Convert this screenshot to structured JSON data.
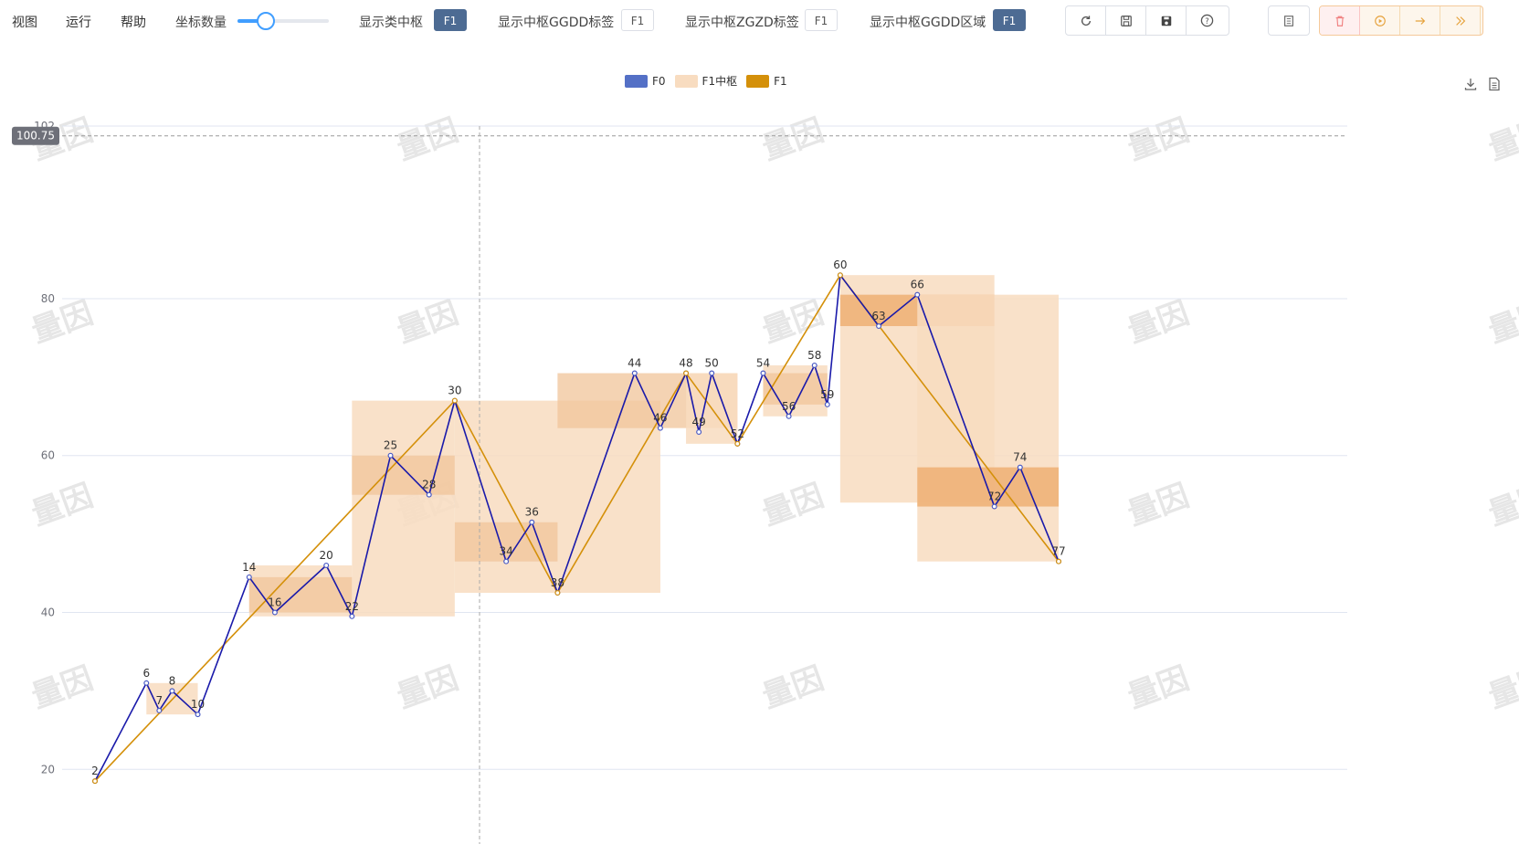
{
  "menu": {
    "view": "视图",
    "run": "运行",
    "help": "帮助"
  },
  "toolbar": {
    "axis_count_label": "坐标数量",
    "axis_count_fraction": 0.3,
    "toggles": [
      {
        "label": "显示类中枢",
        "value": "F1",
        "active": true
      },
      {
        "label": "显示中枢GGDD标签",
        "value": "F1",
        "active": false
      },
      {
        "label": "显示中枢ZGZD标签",
        "value": "F1",
        "active": false
      },
      {
        "label": "显示中枢GGDD区域",
        "value": "F1",
        "active": true
      }
    ],
    "icon_group_1": [
      "refresh-icon",
      "save-outline-icon",
      "save-filled-icon",
      "help-icon"
    ],
    "icon_group_2": [
      "document-icon"
    ],
    "icon_group_3": [
      "trash-icon",
      "play-circle-icon",
      "arrow-right-icon",
      "double-chevron-right-icon"
    ],
    "download_icon": "download-icon",
    "data_view_icon": "data-view-icon"
  },
  "watermark": "量因",
  "colors": {
    "f0": "#1a1aaa",
    "f0_legend": "#5470c6",
    "f1": "#d4900a",
    "zs_light": "#f8dcc0",
    "zs_mid": "#f0c49a",
    "zs_dark": "#eeac6e"
  },
  "chart_data": {
    "type": "line",
    "ylim": [
      12,
      102
    ],
    "yticks": [
      20,
      40,
      60,
      80
    ],
    "ytick_top": "102",
    "crosshair_value": "100.75",
    "legend": [
      {
        "name": "F0",
        "color": "#5470c6"
      },
      {
        "name": "F1中枢",
        "color": "#f8dcc0"
      },
      {
        "name": "F1",
        "color": "#d4900a"
      }
    ],
    "series": [
      {
        "name": "F0",
        "points": [
          [
            2,
            18.5
          ],
          [
            6,
            31
          ],
          [
            7,
            27.5
          ],
          [
            8,
            30
          ],
          [
            10,
            27
          ],
          [
            14,
            44.5
          ],
          [
            16,
            40
          ],
          [
            20,
            46
          ],
          [
            22,
            39.5
          ],
          [
            25,
            60
          ],
          [
            28,
            55
          ],
          [
            30,
            67
          ],
          [
            34,
            46.5
          ],
          [
            36,
            51.5
          ],
          [
            38,
            42.5
          ],
          [
            44,
            70.5
          ],
          [
            46,
            63.5
          ],
          [
            48,
            70.5
          ],
          [
            49,
            63
          ],
          [
            50,
            70.5
          ],
          [
            52,
            61.5
          ],
          [
            54,
            70.5
          ],
          [
            56,
            65
          ],
          [
            58,
            71.5
          ],
          [
            59,
            66.5
          ],
          [
            60,
            83
          ],
          [
            63,
            76.5
          ],
          [
            66,
            80.5
          ],
          [
            72,
            53.5
          ],
          [
            74,
            58.5
          ],
          [
            77,
            46.5
          ]
        ]
      },
      {
        "name": "F1",
        "points": [
          [
            2,
            18.5
          ],
          [
            30,
            67
          ],
          [
            38,
            42.5
          ],
          [
            48,
            70.5
          ],
          [
            52,
            61.5
          ],
          [
            60,
            83
          ],
          [
            77,
            46.5
          ]
        ]
      }
    ],
    "zhongshu": [
      {
        "x": [
          6,
          10
        ],
        "y": [
          27,
          31
        ],
        "tone": "light"
      },
      {
        "x": [
          14,
          22
        ],
        "y": [
          39.5,
          46
        ],
        "tone": "light"
      },
      {
        "x": [
          14,
          22
        ],
        "y": [
          40,
          44.5
        ],
        "tone": "mid"
      },
      {
        "x": [
          22,
          30
        ],
        "y": [
          39.5,
          67
        ],
        "tone": "light"
      },
      {
        "x": [
          22,
          30
        ],
        "y": [
          55,
          60
        ],
        "tone": "mid"
      },
      {
        "x": [
          30,
          46
        ],
        "y": [
          42.5,
          67
        ],
        "tone": "light"
      },
      {
        "x": [
          30,
          38
        ],
        "y": [
          46.5,
          51.5
        ],
        "tone": "mid"
      },
      {
        "x": [
          38,
          52
        ],
        "y": [
          63.5,
          70.5
        ],
        "tone": "mid"
      },
      {
        "x": [
          48,
          52
        ],
        "y": [
          61.5,
          70.5
        ],
        "tone": "light"
      },
      {
        "x": [
          54,
          59
        ],
        "y": [
          65,
          71.5
        ],
        "tone": "light"
      },
      {
        "x": [
          54,
          59
        ],
        "y": [
          66.5,
          70.5
        ],
        "tone": "mid"
      },
      {
        "x": [
          60,
          72
        ],
        "y": [
          54,
          83
        ],
        "tone": "light"
      },
      {
        "x": [
          60,
          72
        ],
        "y": [
          76.5,
          80.5
        ],
        "tone": "dark"
      },
      {
        "x": [
          66,
          77
        ],
        "y": [
          46.5,
          80.5
        ],
        "tone": "light"
      },
      {
        "x": [
          66,
          77
        ],
        "y": [
          53.5,
          58.5
        ],
        "tone": "dark"
      }
    ],
    "grid": true,
    "legend_position": "top-center"
  }
}
